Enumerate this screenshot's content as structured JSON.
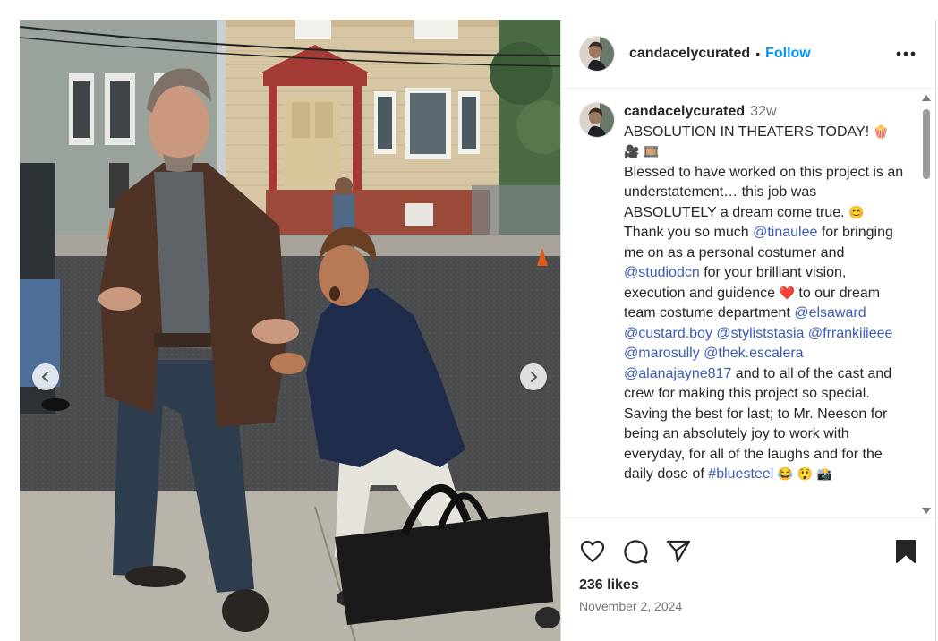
{
  "post": {
    "username": "candacelycurated",
    "follow_label": "Follow",
    "separator": "•",
    "caption": {
      "username": "candacelycurated",
      "time_ago": "32w",
      "line1": "ABSOLUTION IN THEATERS TODAY!",
      "para2_a": "Blessed to have worked on this project is an understatement… this job was ABSOLUTELY a dream come true.",
      "para3_a": "Thank you so much",
      "mention_tinaulee": "@tinaulee",
      "para3_b": "for bringing me on as a personal costumer and",
      "mention_studiodcn": "@studiodcn",
      "para3_c": "for your brilliant vision, execution and guidence",
      "para3_d": "to our dream team costume department",
      "mention_elsaward": "@elsaward",
      "mention_custard": "@custard.boy",
      "mention_styliststasia": "@styliststasia",
      "mention_frrankiiieee": "@frrankiiieee",
      "mention_marosully": "@marosully",
      "mention_thek": "@thek.escalera",
      "mention_alanajayne": "@alanajayne817",
      "para3_e": "and to all of the cast and crew for making this project so special.",
      "para4_a": "Saving the best for last; to Mr. Neeson for being an absolutely joy to work with everyday, for all of the laughs and for the daily dose of",
      "hashtag_bluesteel": "#bluesteel"
    },
    "emojis": {
      "popcorn": "🍿",
      "camera": "🎥",
      "film": "🎞️",
      "smile": "😊",
      "heart": "❤️",
      "laugh": "😂",
      "shock": "😲",
      "photo": "📸"
    },
    "likes_text": "236 likes",
    "date_text": "November 2, 2024"
  },
  "icons": {
    "more": "more-options-icon",
    "like": "heart-icon",
    "comment": "comment-icon",
    "share": "send-icon",
    "save": "bookmark-icon",
    "prev": "chevron-left-icon",
    "next": "chevron-right-icon"
  },
  "colors": {
    "accent": "#0095f6",
    "mention": "#3b5bb5",
    "muted": "#737373",
    "text": "#262626"
  }
}
